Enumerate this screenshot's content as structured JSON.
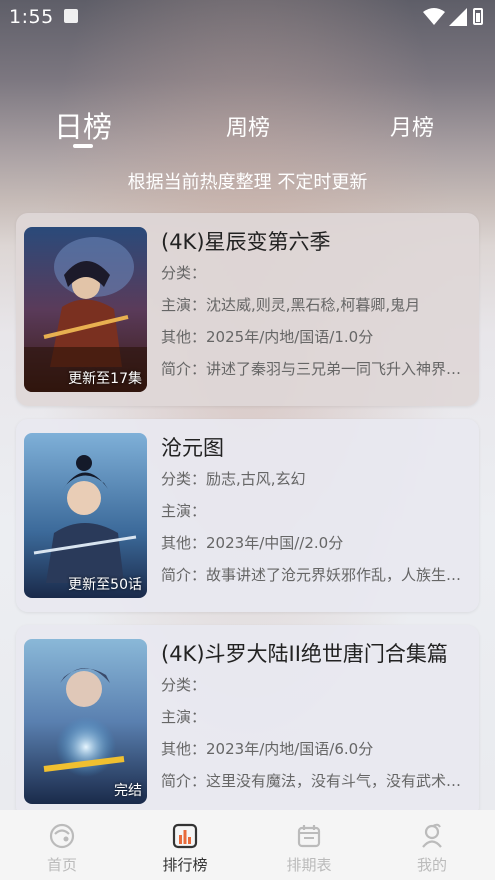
{
  "status_bar": {
    "time": "1:55"
  },
  "tabs": [
    {
      "label": "日榜",
      "active": true
    },
    {
      "label": "周榜",
      "active": false
    },
    {
      "label": "月榜",
      "active": false
    }
  ],
  "subtitle": "根据当前热度整理 不定时更新",
  "items": [
    {
      "title": "(4K)星辰变第六季",
      "badge": "更新至17集",
      "genre_label": "分类：",
      "genre": "",
      "cast_label": "主演：",
      "cast": "沈达威,则灵,黑石稔,柯暮卿,鬼月",
      "other_label": "其他：",
      "other": "2025年/内地/国语/1.0分",
      "desc_label": "简介：",
      "desc": "讲述了秦羽与三兄弟一同飞升入神界后的故事"
    },
    {
      "title": "沧元图",
      "badge": "更新至50话",
      "genre_label": "分类：",
      "genre": "励志,古风,玄幻",
      "cast_label": "主演：",
      "cast": "",
      "other_label": "其他：",
      "other": "2023年/中国//2.0分",
      "desc_label": "简介：",
      "desc": "故事讲述了沧元界妖邪作乱，人族生存艰难的故事"
    },
    {
      "title": "(4K)斗罗大陆II绝世唐门合集篇",
      "badge": "完结",
      "genre_label": "分类：",
      "genre": "",
      "cast_label": "主演：",
      "cast": "",
      "other_label": "其他：",
      "other": "2023年/内地/国语/6.0分",
      "desc_label": "简介：",
      "desc": "这里没有魔法，没有斗气，没有武术的世界"
    }
  ],
  "bottom_nav": [
    {
      "label": "首页",
      "icon": "home-icon",
      "active": false
    },
    {
      "label": "排行榜",
      "icon": "ranking-icon",
      "active": true
    },
    {
      "label": "排期表",
      "icon": "calendar-icon",
      "active": false
    },
    {
      "label": "我的",
      "icon": "profile-icon",
      "active": false
    }
  ],
  "colors": {
    "active_text": "#333333",
    "inactive_text": "#bbbbbb",
    "tab_text": "#ffffff"
  }
}
